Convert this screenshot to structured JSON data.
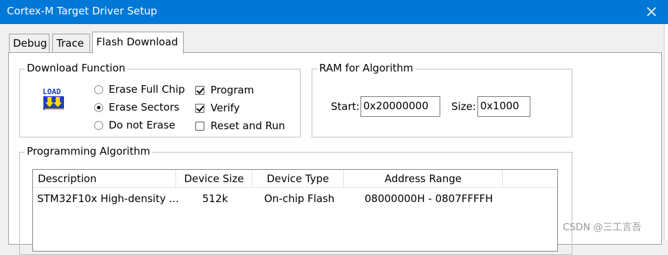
{
  "window": {
    "title": "Cortex-M Target Driver Setup",
    "close_glyph": "✕"
  },
  "tabs": [
    {
      "label": "Debug",
      "active": false
    },
    {
      "label": "Trace",
      "active": false
    },
    {
      "label": "Flash Download",
      "active": true
    }
  ],
  "download_function": {
    "legend": "Download Function",
    "icon": "load-icon",
    "icon_text": "LOAD",
    "radios": [
      {
        "label": "Erase Full Chip",
        "selected": false
      },
      {
        "label": "Erase Sectors",
        "selected": true
      },
      {
        "label": "Do not Erase",
        "selected": false
      }
    ],
    "checks": [
      {
        "label": "Program",
        "checked": true
      },
      {
        "label": "Verify",
        "checked": true
      },
      {
        "label": "Reset and Run",
        "checked": false
      }
    ]
  },
  "ram": {
    "legend": "RAM for Algorithm",
    "start_label": "Start:",
    "start_value": "0x20000000",
    "size_label": "Size:",
    "size_value": "0x1000"
  },
  "algorithm": {
    "legend": "Programming Algorithm",
    "columns": [
      "Description",
      "Device Size",
      "Device Type",
      "Address Range"
    ],
    "rows": [
      [
        "STM32F10x High-density ...",
        "512k",
        "On-chip Flash",
        "08000000H - 0807FFFFH"
      ]
    ]
  },
  "watermark": "CSDN @三工言吾",
  "colors": {
    "titlebar": "#0078d7",
    "dialog_bg": "#f0f0f0",
    "icon_blue": "#1f3fbf",
    "icon_yellow": "#ffd800"
  }
}
